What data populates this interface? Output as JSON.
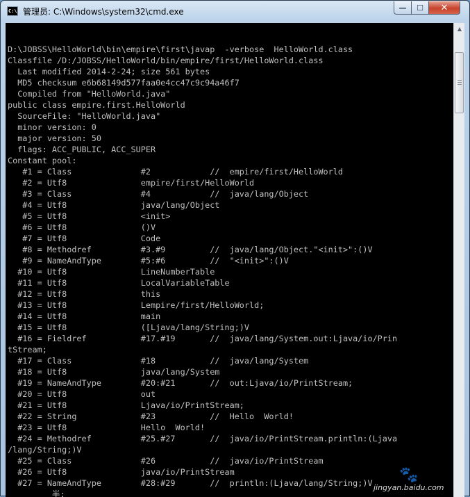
{
  "window": {
    "title": "管理员: C:\\Windows\\system32\\cmd.exe",
    "icon_text": "C:\\",
    "controls": {
      "minimize": "—",
      "maximize": "☐",
      "close": "✕"
    }
  },
  "console": {
    "lines": [
      "",
      "D:\\JOBSS\\HelloWorld\\bin\\empire\\first\\javap  -verbose  HelloWorld.class",
      "Classfile /D:/JOBSS/HelloWorld/bin/empire/first/HelloWorld.class",
      "  Last modified 2014-2-24; size 561 bytes",
      "  MD5 checksum e6b68149d577faa0e4cc47c9c94a46f7",
      "  Compiled from \"HelloWorld.java\"",
      "public class empire.first.HelloWorld",
      "  SourceFile: \"HelloWorld.java\"",
      "  minor version: 0",
      "  major version: 50",
      "  flags: ACC_PUBLIC, ACC_SUPER",
      "Constant pool:",
      "   #1 = Class              #2            //  empire/first/HelloWorld",
      "   #2 = Utf8               empire/first/HelloWorld",
      "   #3 = Class              #4            //  java/lang/Object",
      "   #4 = Utf8               java/lang/Object",
      "   #5 = Utf8               <init>",
      "   #6 = Utf8               ()V",
      "   #7 = Utf8               Code",
      "   #8 = Methodref          #3.#9         //  java/lang/Object.\"<init>\":()V",
      "   #9 = NameAndType        #5:#6         //  \"<init>\":()V",
      "  #10 = Utf8               LineNumberTable",
      "  #11 = Utf8               LocalVariableTable",
      "  #12 = Utf8               this",
      "  #13 = Utf8               Lempire/first/HelloWorld;",
      "  #14 = Utf8               main",
      "  #15 = Utf8               ([Ljava/lang/String;)V",
      "  #16 = Fieldref           #17.#19       //  java/lang/System.out:Ljava/io/Prin",
      "tStream;",
      "  #17 = Class              #18           //  java/lang/System",
      "  #18 = Utf8               java/lang/System",
      "  #19 = NameAndType        #20:#21       //  out:Ljava/io/PrintStream;",
      "  #20 = Utf8               out",
      "  #21 = Utf8               Ljava/io/PrintStream;",
      "  #22 = String             #23           //  Hello  World!",
      "  #23 = Utf8               Hello  World!",
      "  #24 = Methodref          #25.#27       //  java/io/PrintStream.println:(Ljava",
      "/lang/String;)V",
      "  #25 = Class              #26           //  java/io/PrintStream",
      "  #26 = Utf8               java/io/PrintStream",
      "  #27 = NameAndType        #28:#29       //  println:(Ljava/lang/String;)V",
      "         半:"
    ]
  },
  "watermark": {
    "text": "jingyan.baidu.com"
  }
}
